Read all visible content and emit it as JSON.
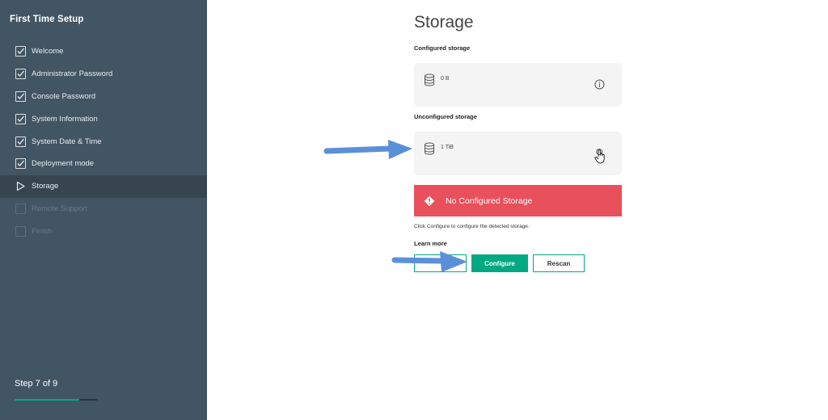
{
  "sidebar": {
    "title": "First Time Setup",
    "steps": [
      {
        "label": "Welcome",
        "state": "done"
      },
      {
        "label": "Administrator Password",
        "state": "done"
      },
      {
        "label": "Console Password",
        "state": "done"
      },
      {
        "label": "System Information",
        "state": "done"
      },
      {
        "label": "System Date & Time",
        "state": "done"
      },
      {
        "label": "Deployment mode",
        "state": "done"
      },
      {
        "label": "Storage",
        "state": "current"
      },
      {
        "label": "Remote Support",
        "state": "pending"
      },
      {
        "label": "Finish",
        "state": "pending"
      }
    ],
    "step_counter": "Step 7 of 9",
    "progress_fraction": 0.78
  },
  "main": {
    "title": "Storage",
    "configured_label": "Configured storage",
    "configured_size": "0 B",
    "unconfigured_label": "Unconfigured storage",
    "unconfigured_size": "1 TiB",
    "banner_text": "No Configured Storage",
    "hint": "Click Configure to configure the detected storage.",
    "learn_more": "Learn more",
    "buttons": {
      "back": "",
      "configure": "Configure",
      "rescan": "Rescan"
    }
  },
  "colors": {
    "sidebar_bg": "#425563",
    "accent": "#01a982",
    "error": "#e8505b",
    "annotation_arrow": "#5b8fd8"
  },
  "icons": [
    "checkbox-checked-icon",
    "play-icon",
    "checkbox-empty-icon",
    "database-icon",
    "info-icon",
    "hand-pointer-icon",
    "warning-diamond-icon",
    "annotation-arrow"
  ]
}
